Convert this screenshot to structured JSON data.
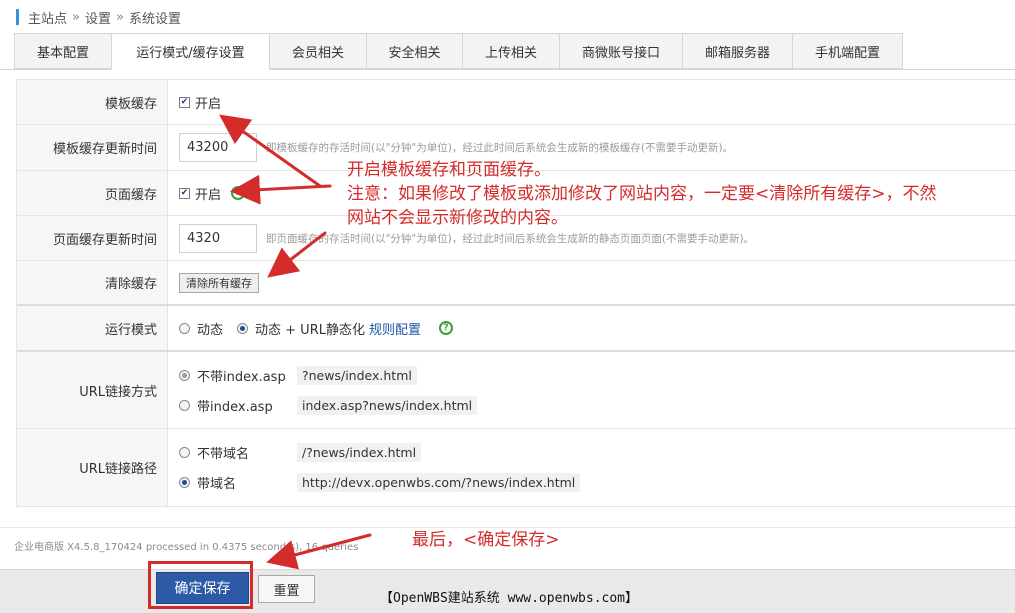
{
  "breadcrumb": {
    "home": "主站点",
    "level1": "设置",
    "level2": "系统设置",
    "separator": "»"
  },
  "tabs": [
    {
      "label": "基本配置"
    },
    {
      "label": "运行模式/缓存设置"
    },
    {
      "label": "会员相关"
    },
    {
      "label": "安全相关"
    },
    {
      "label": "上传相关"
    },
    {
      "label": "商微账号接口"
    },
    {
      "label": "邮箱服务器"
    },
    {
      "label": "手机端配置"
    }
  ],
  "active_tab": "运行模式/缓存设置",
  "form": {
    "template_cache": {
      "label": "模板缓存",
      "checkbox_label": "开启",
      "checked": true
    },
    "template_cache_time": {
      "label": "模板缓存更新时间",
      "value": "43200",
      "hint": "即模板缓存的存活时间(以\"分钟\"为单位)，经过此时间后系统会生成新的模板缓存(不需要手动更新)。"
    },
    "page_cache": {
      "label": "页面缓存",
      "checkbox_label": "开启",
      "checked": true,
      "help": "?"
    },
    "page_cache_time": {
      "label": "页面缓存更新时间",
      "value": "4320",
      "hint": "即页面缓存的存活时间(以\"分钟\"为单位)，经过此时间后系统会生成新的静态页面页面(不需要手动更新)。"
    },
    "clear_cache": {
      "label": "清除缓存",
      "button": "清除所有缓存"
    },
    "run_mode": {
      "label": "运行模式",
      "option1": "动态",
      "option2": "动态 + URL静态化",
      "link": "规则配置",
      "help": "?"
    },
    "url_mode": {
      "label": "URL链接方式",
      "option1": "不带index.asp",
      "option1_example": "?news/index.html",
      "option2": "带index.asp",
      "option2_example": "index.asp?news/index.html"
    },
    "url_path": {
      "label": "URL链接路径",
      "option1": "不带域名",
      "option1_example": "/?news/index.html",
      "option2": "带域名",
      "option2_example": "http://devx.openwbs.com/?news/index.html"
    }
  },
  "footer": {
    "processed": "企业电商版 X4.5.8_170424 processed in 0.4375 second(s), 16 queries",
    "save_button": "确定保存",
    "reset_button": "重置",
    "brand": "【OpenWBS建站系统 www.openwbs.com】"
  },
  "annotations": {
    "line1": "开启模板缓存和页面缓存。",
    "line2": "注意：如果修改了模板或添加修改了网站内容，一定要<清除所有缓存>，不然",
    "line3": "网站不会显示新修改的内容。",
    "final": "最后，<确定保存>"
  },
  "colors": {
    "accent": "#2d5aa6",
    "annotation": "#d42b2b",
    "help": "#3aa03a",
    "link": "#1e56a8"
  },
  "icons": {
    "help": "help-circle-icon",
    "checkbox": "checkbox-checked-icon"
  }
}
